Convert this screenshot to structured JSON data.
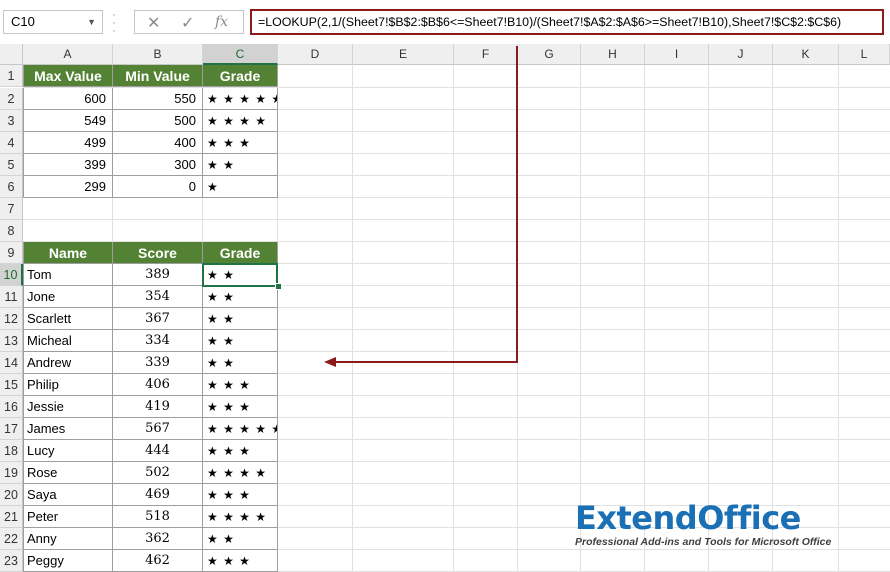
{
  "formula_bar": {
    "name_box": "C10",
    "cancel_icon": "✕",
    "enter_icon": "✓",
    "fx_label": "fx",
    "formula": "=LOOKUP(2,1/(Sheet7!$B$2:$B$6<=Sheet7!B10)/(Sheet7!$A$2:$A$6>=Sheet7!B10),Sheet7!$C$2:$C$6)"
  },
  "columns": [
    "A",
    "B",
    "C",
    "D",
    "E",
    "F",
    "G",
    "H",
    "I",
    "J",
    "K",
    "L"
  ],
  "rows": [
    "1",
    "2",
    "3",
    "4",
    "5",
    "6",
    "7",
    "8",
    "9",
    "10",
    "11",
    "12",
    "13",
    "14",
    "15",
    "16",
    "17",
    "18",
    "19",
    "20",
    "21",
    "22",
    "23"
  ],
  "selected_cell": {
    "column": "C",
    "row": "10"
  },
  "grade_table": {
    "headers": [
      "Max Value",
      "Min Value",
      "Grade"
    ],
    "rows": [
      [
        "600",
        "550",
        "★ ★ ★ ★ ★"
      ],
      [
        "549",
        "500",
        "★ ★ ★ ★"
      ],
      [
        "499",
        "400",
        "★ ★ ★"
      ],
      [
        "399",
        "300",
        "★ ★"
      ],
      [
        "299",
        "0",
        "★"
      ]
    ]
  },
  "score_table": {
    "headers": [
      "Name",
      "Score",
      "Grade"
    ],
    "rows": [
      [
        "Tom",
        "389",
        "★ ★"
      ],
      [
        "Jone",
        "354",
        "★ ★"
      ],
      [
        "Scarlett",
        "367",
        "★ ★"
      ],
      [
        "Micheal",
        "334",
        "★ ★"
      ],
      [
        "Andrew",
        "339",
        "★ ★"
      ],
      [
        "Philip",
        "406",
        "★ ★ ★"
      ],
      [
        "Jessie",
        "419",
        "★ ★ ★"
      ],
      [
        "James",
        "567",
        "★ ★ ★ ★ ★"
      ],
      [
        "Lucy",
        "444",
        "★ ★ ★"
      ],
      [
        "Rose",
        "502",
        "★ ★ ★ ★"
      ],
      [
        "Saya",
        "469",
        "★ ★ ★"
      ],
      [
        "Peter",
        "518",
        "★ ★ ★ ★"
      ],
      [
        "Anny",
        "362",
        "★ ★"
      ],
      [
        "Peggy",
        "462",
        "★ ★ ★"
      ]
    ]
  },
  "logo": {
    "name": "ExtendOffice",
    "tagline": "Professional Add-ins and Tools for Microsoft Office"
  },
  "colors": {
    "header_green": "#548235",
    "selection_green": "#217346",
    "arrow_red": "#8b1a1a",
    "logo_blue": "#1a6fb5"
  }
}
